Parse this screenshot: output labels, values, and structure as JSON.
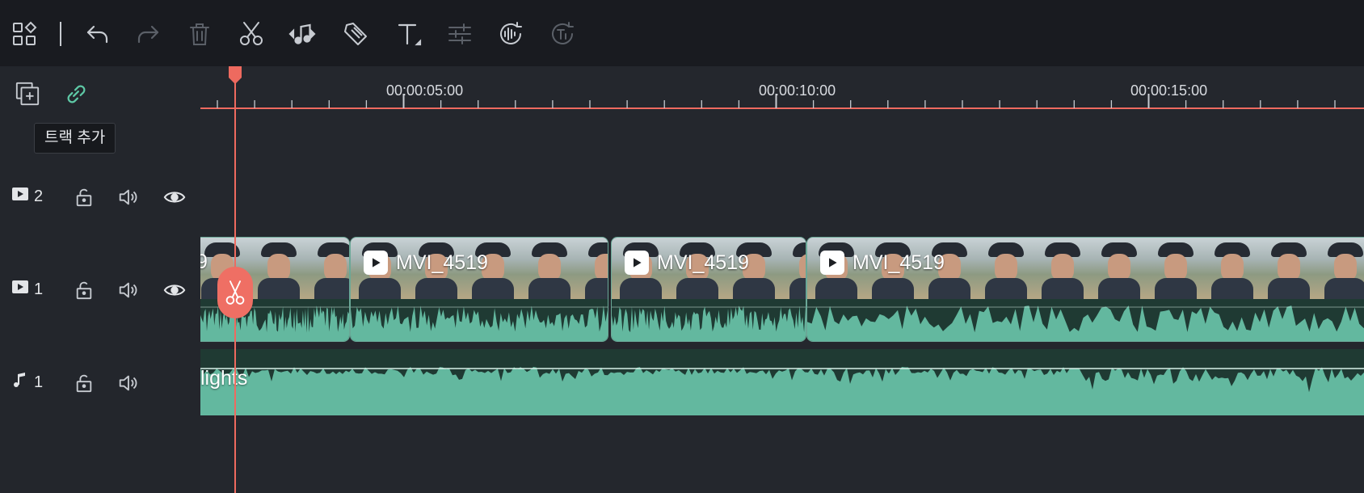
{
  "toolbar": {
    "icons": [
      "grid-layout-icon",
      "undo-icon",
      "redo-icon",
      "delete-icon",
      "split-scissors-icon",
      "audio-music-icon",
      "tag-marker-icon",
      "text-title-icon",
      "adjust-sliders-icon",
      "audio-detect-icon",
      "speech-to-text-icon"
    ]
  },
  "header": {
    "tooltip": "트랙 추가"
  },
  "tracks": {
    "video2": {
      "number": "2"
    },
    "video1": {
      "number": "1"
    },
    "audio1": {
      "number": "1"
    }
  },
  "ruler": {
    "labels": [
      "00:00:05:00",
      "00:00:10:00",
      "00:00:15:00"
    ]
  },
  "clips": {
    "partial_label": "9",
    "clip1_label": "MVI_4519",
    "clip2_label": "MVI_4519",
    "clip3_label": "MVI_4519",
    "audio_label": "lights"
  },
  "colors": {
    "accent_playhead": "#ee6a5f",
    "clip_green": "#5fb29a",
    "link_teal": "#5ec9a6",
    "toolbar_bg": "#191b20"
  }
}
